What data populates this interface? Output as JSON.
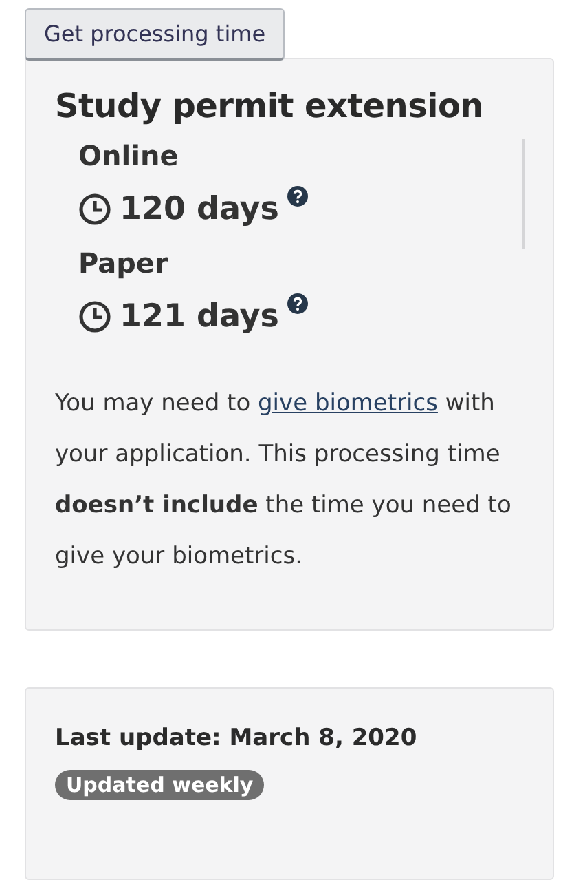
{
  "button": {
    "label": "Get processing time"
  },
  "result": {
    "title": "Study permit extension",
    "methods": [
      {
        "label": "Online",
        "time": "120 days"
      },
      {
        "label": "Paper",
        "time": "121 days"
      }
    ],
    "note": {
      "before": "You may need to ",
      "link": "give biometrics",
      "after": " with your application. This processing time **doesn’t include** the time you need to give your biometrics."
    }
  },
  "update": {
    "text": "Last update: March 8, 2020",
    "badge": "Updated weekly"
  }
}
